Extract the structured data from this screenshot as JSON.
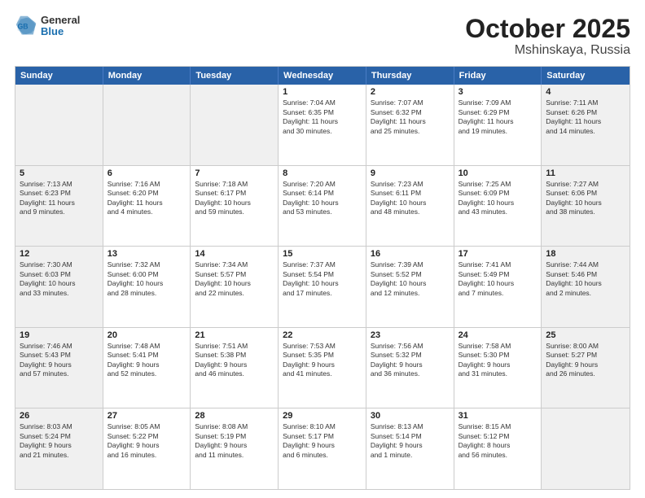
{
  "header": {
    "logo_general": "General",
    "logo_blue": "Blue",
    "title": "October 2025",
    "location": "Mshinskaya, Russia"
  },
  "days_of_week": [
    "Sunday",
    "Monday",
    "Tuesday",
    "Wednesday",
    "Thursday",
    "Friday",
    "Saturday"
  ],
  "weeks": [
    [
      {
        "day": "",
        "info": "",
        "shaded": true
      },
      {
        "day": "",
        "info": "",
        "shaded": true
      },
      {
        "day": "",
        "info": "",
        "shaded": true
      },
      {
        "day": "1",
        "info": "Sunrise: 7:04 AM\nSunset: 6:35 PM\nDaylight: 11 hours\nand 30 minutes.",
        "shaded": false
      },
      {
        "day": "2",
        "info": "Sunrise: 7:07 AM\nSunset: 6:32 PM\nDaylight: 11 hours\nand 25 minutes.",
        "shaded": false
      },
      {
        "day": "3",
        "info": "Sunrise: 7:09 AM\nSunset: 6:29 PM\nDaylight: 11 hours\nand 19 minutes.",
        "shaded": false
      },
      {
        "day": "4",
        "info": "Sunrise: 7:11 AM\nSunset: 6:26 PM\nDaylight: 11 hours\nand 14 minutes.",
        "shaded": true
      }
    ],
    [
      {
        "day": "5",
        "info": "Sunrise: 7:13 AM\nSunset: 6:23 PM\nDaylight: 11 hours\nand 9 minutes.",
        "shaded": true
      },
      {
        "day": "6",
        "info": "Sunrise: 7:16 AM\nSunset: 6:20 PM\nDaylight: 11 hours\nand 4 minutes.",
        "shaded": false
      },
      {
        "day": "7",
        "info": "Sunrise: 7:18 AM\nSunset: 6:17 PM\nDaylight: 10 hours\nand 59 minutes.",
        "shaded": false
      },
      {
        "day": "8",
        "info": "Sunrise: 7:20 AM\nSunset: 6:14 PM\nDaylight: 10 hours\nand 53 minutes.",
        "shaded": false
      },
      {
        "day": "9",
        "info": "Sunrise: 7:23 AM\nSunset: 6:11 PM\nDaylight: 10 hours\nand 48 minutes.",
        "shaded": false
      },
      {
        "day": "10",
        "info": "Sunrise: 7:25 AM\nSunset: 6:09 PM\nDaylight: 10 hours\nand 43 minutes.",
        "shaded": false
      },
      {
        "day": "11",
        "info": "Sunrise: 7:27 AM\nSunset: 6:06 PM\nDaylight: 10 hours\nand 38 minutes.",
        "shaded": true
      }
    ],
    [
      {
        "day": "12",
        "info": "Sunrise: 7:30 AM\nSunset: 6:03 PM\nDaylight: 10 hours\nand 33 minutes.",
        "shaded": true
      },
      {
        "day": "13",
        "info": "Sunrise: 7:32 AM\nSunset: 6:00 PM\nDaylight: 10 hours\nand 28 minutes.",
        "shaded": false
      },
      {
        "day": "14",
        "info": "Sunrise: 7:34 AM\nSunset: 5:57 PM\nDaylight: 10 hours\nand 22 minutes.",
        "shaded": false
      },
      {
        "day": "15",
        "info": "Sunrise: 7:37 AM\nSunset: 5:54 PM\nDaylight: 10 hours\nand 17 minutes.",
        "shaded": false
      },
      {
        "day": "16",
        "info": "Sunrise: 7:39 AM\nSunset: 5:52 PM\nDaylight: 10 hours\nand 12 minutes.",
        "shaded": false
      },
      {
        "day": "17",
        "info": "Sunrise: 7:41 AM\nSunset: 5:49 PM\nDaylight: 10 hours\nand 7 minutes.",
        "shaded": false
      },
      {
        "day": "18",
        "info": "Sunrise: 7:44 AM\nSunset: 5:46 PM\nDaylight: 10 hours\nand 2 minutes.",
        "shaded": true
      }
    ],
    [
      {
        "day": "19",
        "info": "Sunrise: 7:46 AM\nSunset: 5:43 PM\nDaylight: 9 hours\nand 57 minutes.",
        "shaded": true
      },
      {
        "day": "20",
        "info": "Sunrise: 7:48 AM\nSunset: 5:41 PM\nDaylight: 9 hours\nand 52 minutes.",
        "shaded": false
      },
      {
        "day": "21",
        "info": "Sunrise: 7:51 AM\nSunset: 5:38 PM\nDaylight: 9 hours\nand 46 minutes.",
        "shaded": false
      },
      {
        "day": "22",
        "info": "Sunrise: 7:53 AM\nSunset: 5:35 PM\nDaylight: 9 hours\nand 41 minutes.",
        "shaded": false
      },
      {
        "day": "23",
        "info": "Sunrise: 7:56 AM\nSunset: 5:32 PM\nDaylight: 9 hours\nand 36 minutes.",
        "shaded": false
      },
      {
        "day": "24",
        "info": "Sunrise: 7:58 AM\nSunset: 5:30 PM\nDaylight: 9 hours\nand 31 minutes.",
        "shaded": false
      },
      {
        "day": "25",
        "info": "Sunrise: 8:00 AM\nSunset: 5:27 PM\nDaylight: 9 hours\nand 26 minutes.",
        "shaded": true
      }
    ],
    [
      {
        "day": "26",
        "info": "Sunrise: 8:03 AM\nSunset: 5:24 PM\nDaylight: 9 hours\nand 21 minutes.",
        "shaded": true
      },
      {
        "day": "27",
        "info": "Sunrise: 8:05 AM\nSunset: 5:22 PM\nDaylight: 9 hours\nand 16 minutes.",
        "shaded": false
      },
      {
        "day": "28",
        "info": "Sunrise: 8:08 AM\nSunset: 5:19 PM\nDaylight: 9 hours\nand 11 minutes.",
        "shaded": false
      },
      {
        "day": "29",
        "info": "Sunrise: 8:10 AM\nSunset: 5:17 PM\nDaylight: 9 hours\nand 6 minutes.",
        "shaded": false
      },
      {
        "day": "30",
        "info": "Sunrise: 8:13 AM\nSunset: 5:14 PM\nDaylight: 9 hours\nand 1 minute.",
        "shaded": false
      },
      {
        "day": "31",
        "info": "Sunrise: 8:15 AM\nSunset: 5:12 PM\nDaylight: 8 hours\nand 56 minutes.",
        "shaded": false
      },
      {
        "day": "",
        "info": "",
        "shaded": true
      }
    ]
  ]
}
